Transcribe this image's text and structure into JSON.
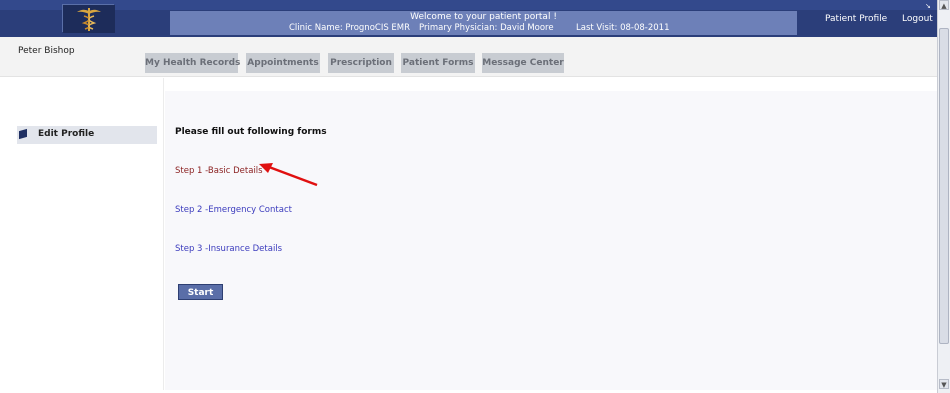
{
  "header": {
    "welcome": "Welcome to your patient portal !",
    "clinic": "Clinic Name: PrognoCIS EMR",
    "physician": "Primary Physician: David Moore",
    "last_visit": "Last Visit: 08-08-2011",
    "patient_profile": "Patient Profile",
    "logout": "Logout"
  },
  "user": {
    "name": "Peter Bishop"
  },
  "tabs": [
    {
      "label": "My Health Records"
    },
    {
      "label": "Appointments"
    },
    {
      "label": "Prescription"
    },
    {
      "label": "Patient Forms"
    },
    {
      "label": "Message Center"
    }
  ],
  "sidebar": {
    "items": [
      {
        "label": "Edit Profile"
      }
    ]
  },
  "main": {
    "title": "Please fill out following forms",
    "steps": [
      {
        "label": "Step 1 -Basic Details"
      },
      {
        "label": "Step 2 -Emergency Contact"
      },
      {
        "label": "Step 3 -Insurance Details"
      }
    ],
    "start_label": "Start"
  },
  "colors": {
    "header_bg": "#2b3e7a",
    "info_bar": "#6d80b8",
    "active_step": "#8a1f1f",
    "link": "#3b3bbd",
    "button": "#5a6ea8",
    "annotation_arrow": "#e01010"
  },
  "icons": [
    "caduceus-logo",
    "edit-profile-icon",
    "annotation-arrow"
  ]
}
